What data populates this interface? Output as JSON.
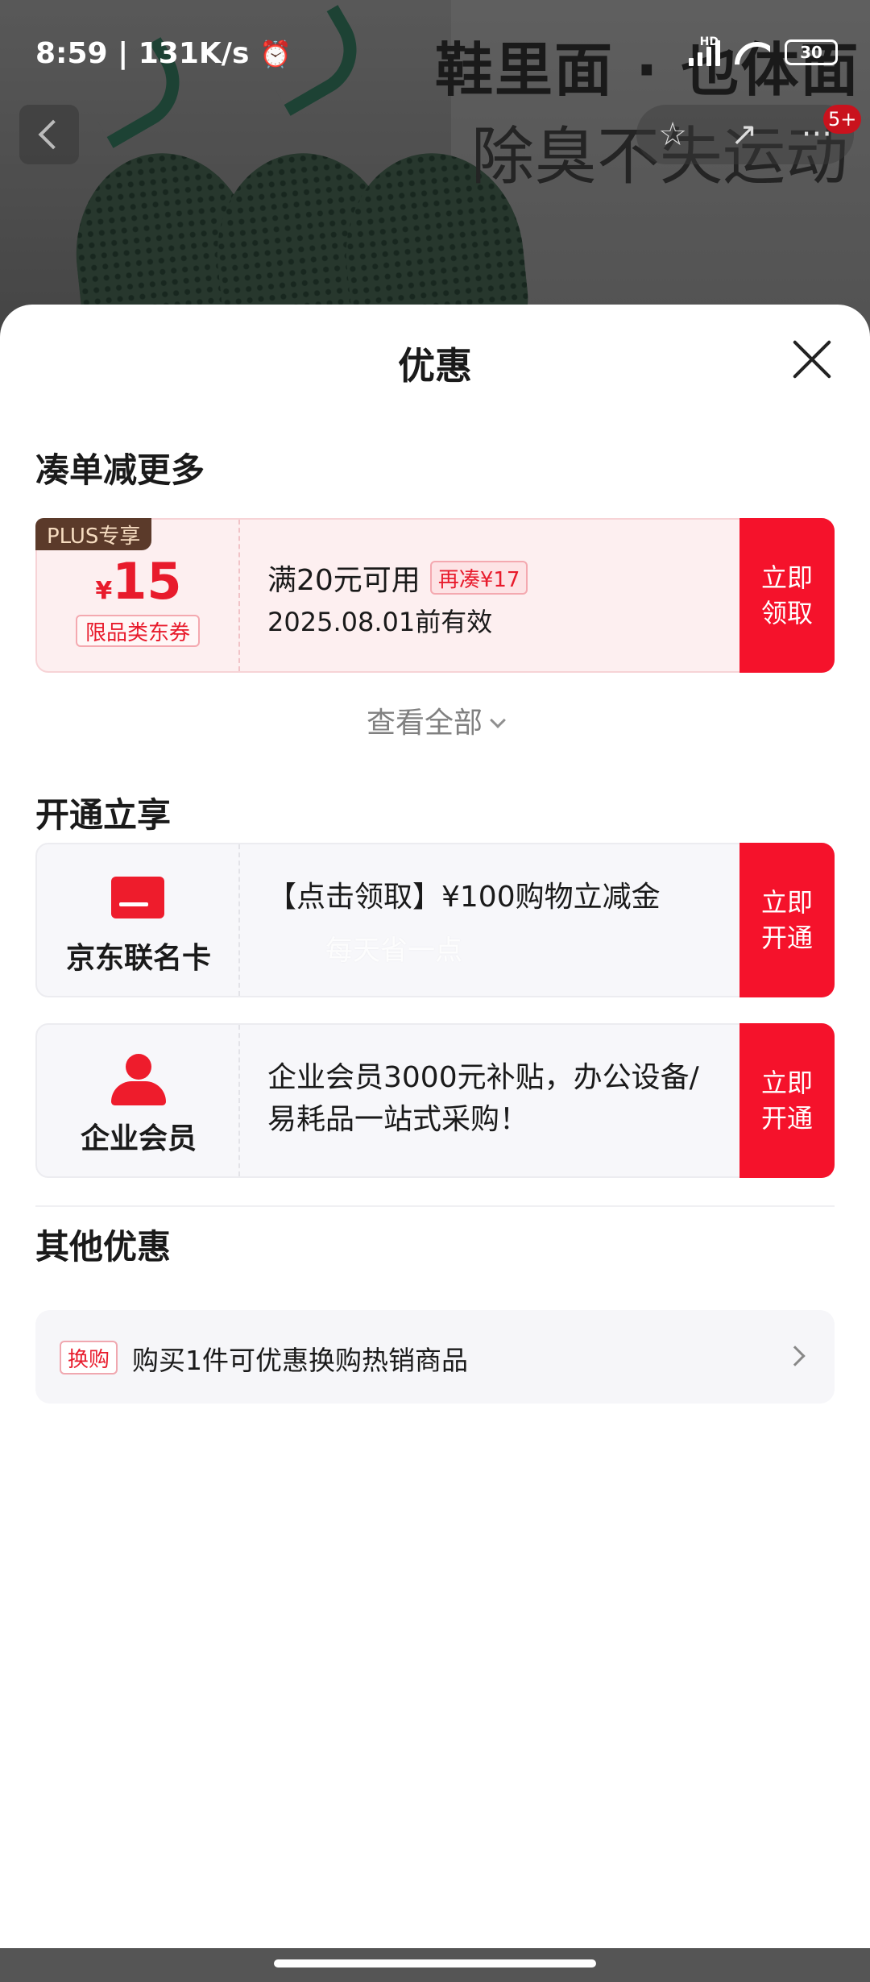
{
  "status_bar": {
    "time": "8:59 | 131K/s",
    "network_type": "HD",
    "battery": "30",
    "icons": [
      "alarm-icon",
      "signal-icon",
      "wifi-icon",
      "battery-icon"
    ]
  },
  "background": {
    "headline": "鞋里面 · 也体面",
    "subline": "除臭不失运动"
  },
  "nav": {
    "message_badge": "5+",
    "icons": [
      "back-icon",
      "star-icon",
      "share-icon",
      "more-icon"
    ]
  },
  "sheet": {
    "title": "优惠",
    "sections": {
      "bundle": {
        "title": "凑单减更多",
        "coupon": {
          "tag": "PLUS专享",
          "currency": "¥",
          "amount": "15",
          "type": "限品类东券",
          "condition": "满20元可用",
          "add_more": "再凑¥17",
          "valid_until": "2025.08.01前有效",
          "button": [
            "立即",
            "领取"
          ]
        },
        "view_all": "查看全部"
      },
      "activate": {
        "title": "开通立享",
        "cards": [
          {
            "label": "京东联名卡",
            "icon": "credit-card-icon",
            "text": "【点击领取】¥100购物立减金",
            "watermark": "每天省一点",
            "button": [
              "立即",
              "开通"
            ]
          },
          {
            "label": "企业会员",
            "icon": "person-icon",
            "text": "企业会员3000元补贴，办公设备/易耗品一站式采购！",
            "button": [
              "立即",
              "开通"
            ]
          }
        ]
      },
      "other": {
        "title": "其他优惠",
        "item": {
          "tag": "换购",
          "text": "购买1件可优惠换购热销商品"
        }
      }
    }
  },
  "colors": {
    "accent_red": "#f5122b",
    "plus_tag_bg": "#5b3a2a",
    "coupon_bg": "#fdeff0"
  }
}
